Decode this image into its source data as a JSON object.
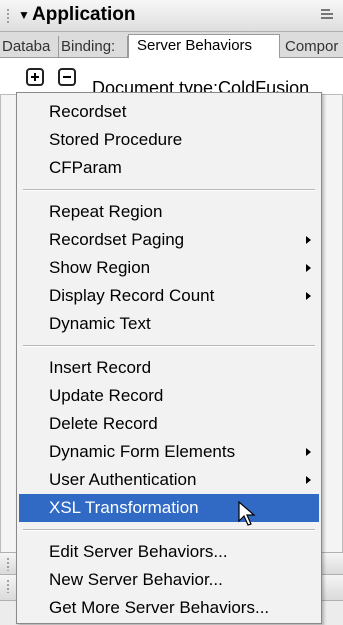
{
  "panel": {
    "title": "Application",
    "collapse_icon": "triangle-down-icon",
    "options_icon": "panel-options-icon"
  },
  "tabs": [
    {
      "label": "Databa",
      "active": false
    },
    {
      "label": "Binding:",
      "active": false
    },
    {
      "label": "Server Behaviors",
      "active": true
    },
    {
      "label": "Compor",
      "active": false
    }
  ],
  "toolbar": {
    "add_icon": "plus-icon",
    "remove_icon": "minus-icon",
    "document_type": "Document type:ColdFusion"
  },
  "menu": {
    "highlight_color": "#316ac5",
    "group1": [
      "Recordset",
      "Stored Procedure",
      "CFParam"
    ],
    "group2": [
      "Repeat Region",
      "Recordset Paging",
      "Show Region",
      "Display Record Count",
      "Dynamic Text"
    ],
    "group3": [
      "Insert Record",
      "Update Record",
      "Delete Record",
      "Dynamic Form Elements",
      "User Authentication",
      "XSL Transformation"
    ],
    "group4": [
      "Edit Server Behaviors...",
      "New Server Behavior...",
      "Get More Server Behaviors..."
    ]
  }
}
